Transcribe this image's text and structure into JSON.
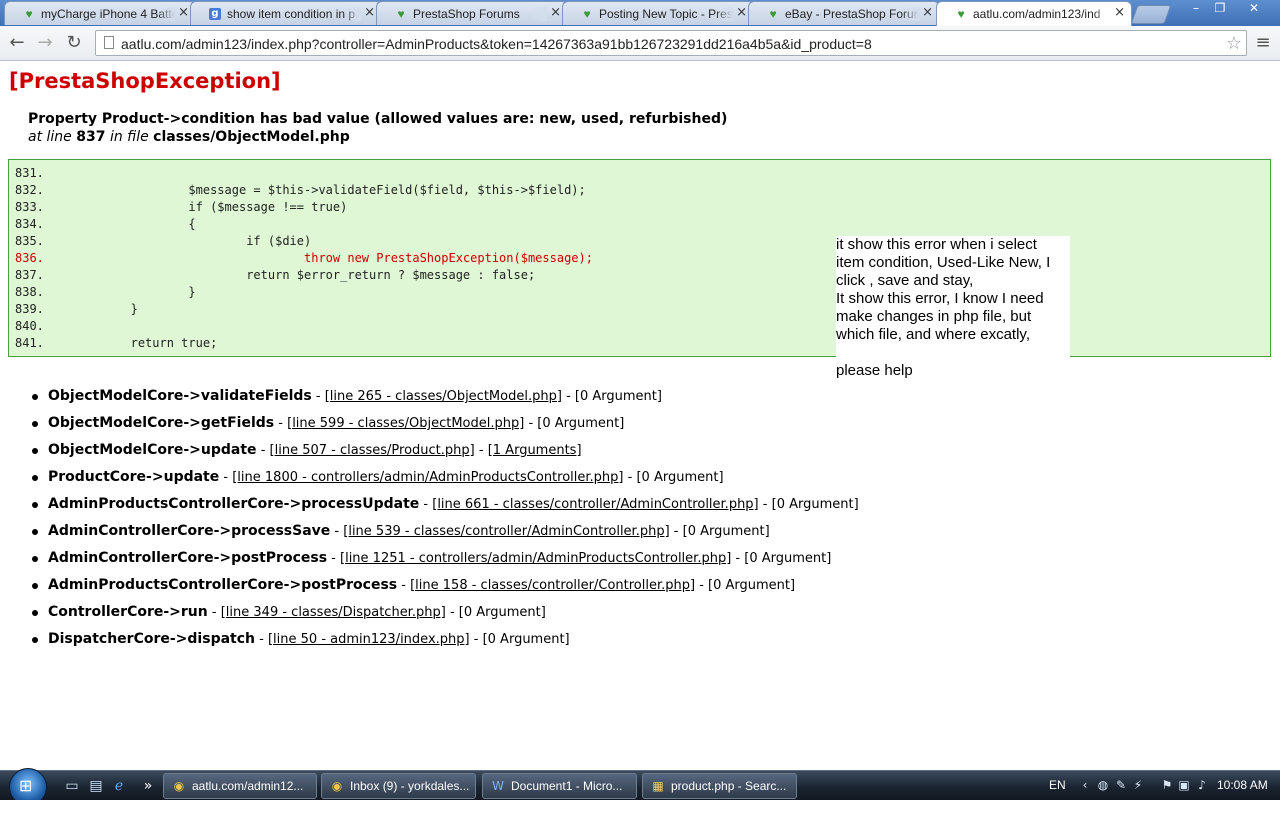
{
  "browser": {
    "tabs": [
      {
        "title": "myCharge iPhone 4 Batte",
        "favicon": "prestashop-icon",
        "active": false
      },
      {
        "title": "show item condition in p",
        "favicon": "google-icon",
        "active": false
      },
      {
        "title": "PrestaShop Forums",
        "favicon": "prestashop-icon",
        "active": false
      },
      {
        "title": "Posting New Topic - Pres",
        "favicon": "prestashop-icon",
        "active": false
      },
      {
        "title": "eBay - PrestaShop Forum",
        "favicon": "prestashop-icon",
        "active": false
      },
      {
        "title": "aatlu.com/admin123/ind",
        "favicon": "prestashop-icon",
        "active": true
      }
    ],
    "close_glyph": "×",
    "url": "aatlu.com/admin123/index.php?controller=AdminProducts&token=14267363a91bb126723291dd216a4b5a&id_product=8",
    "window_controls": {
      "minimize": "–",
      "restore": "❐",
      "close": "✕"
    }
  },
  "error": {
    "title": "[PrestaShopException]",
    "message": "Property Product->condition has bad value (allowed values are: new, used, refurbished)",
    "at_line_prefix": "at line",
    "line_number": "837",
    "in_file_text": "in file",
    "file": "classes/ObjectModel.php",
    "code_lines": [
      {
        "num": "831.",
        "code": ""
      },
      {
        "num": "832.",
        "code": "                    $message = $this->validateField($field, $this->$field);"
      },
      {
        "num": "833.",
        "code": "                    if ($message !== true)"
      },
      {
        "num": "834.",
        "code": "                    {"
      },
      {
        "num": "835.",
        "code": "                            if ($die)"
      },
      {
        "num": "836.",
        "code": "                                    throw new PrestaShopException($message);",
        "error": true
      },
      {
        "num": "837.",
        "code": "                            return $error_return ? $message : false;"
      },
      {
        "num": "838.",
        "code": "                    }"
      },
      {
        "num": "839.",
        "code": "            }"
      },
      {
        "num": "840.",
        "code": ""
      },
      {
        "num": "841.",
        "code": "            return true;"
      }
    ]
  },
  "note": {
    "lines": [
      "it show this error when i select",
      "item condition, Used-Like New, I",
      "click , save and stay,",
      "It show this error, I know I need",
      "make changes in php file, but",
      "which file, and where excatly,",
      "",
      "please help"
    ]
  },
  "trace": [
    {
      "fn": "ObjectModelCore->validateFields",
      "link": "[line 265 - classes/ObjectModel.php]",
      "args": "[0 Argument]",
      "args_link": false
    },
    {
      "fn": "ObjectModelCore->getFields",
      "link": "[line 599 - classes/ObjectModel.php]",
      "args": "[0 Argument]",
      "args_link": false
    },
    {
      "fn": "ObjectModelCore->update",
      "link": "[line 507 - classes/Product.php]",
      "args": "[1 Arguments]",
      "args_link": true
    },
    {
      "fn": "ProductCore->update",
      "link": "[line 1800 - controllers/admin/AdminProductsController.php]",
      "args": "[0 Argument]",
      "args_link": false
    },
    {
      "fn": "AdminProductsControllerCore->processUpdate",
      "link": "[line 661 - classes/controller/AdminController.php]",
      "args": "[0 Argument]",
      "args_link": false
    },
    {
      "fn": "AdminControllerCore->processSave",
      "link": "[line 539 - classes/controller/AdminController.php]",
      "args": "[0 Argument]",
      "args_link": false
    },
    {
      "fn": "AdminControllerCore->postProcess",
      "link": "[line 1251 - controllers/admin/AdminProductsController.php]",
      "args": "[0 Argument]",
      "args_link": false
    },
    {
      "fn": "AdminProductsControllerCore->postProcess",
      "link": "[line 158 - classes/controller/Controller.php]",
      "args": "[0 Argument]",
      "args_link": false
    },
    {
      "fn": "ControllerCore->run",
      "link": "[line 349 - classes/Dispatcher.php]",
      "args": "[0 Argument]",
      "args_link": false
    },
    {
      "fn": "DispatcherCore->dispatch",
      "link": "[line 50 - admin123/index.php]",
      "args": "[0 Argument]",
      "args_link": false
    }
  ],
  "taskbar": {
    "items": [
      {
        "label": "aatlu.com/admin12...",
        "icon": "chrome-icon"
      },
      {
        "label": "Inbox (9) - yorkdales...",
        "icon": "chrome-icon"
      },
      {
        "label": "Document1 - Micro...",
        "icon": "word-icon"
      },
      {
        "label": "product.php - Searc...",
        "icon": "search-folder-icon"
      }
    ],
    "language": "EN",
    "clock": "10:08 AM",
    "overflow_glyph": "»",
    "tray_expand_glyph": "‹"
  }
}
